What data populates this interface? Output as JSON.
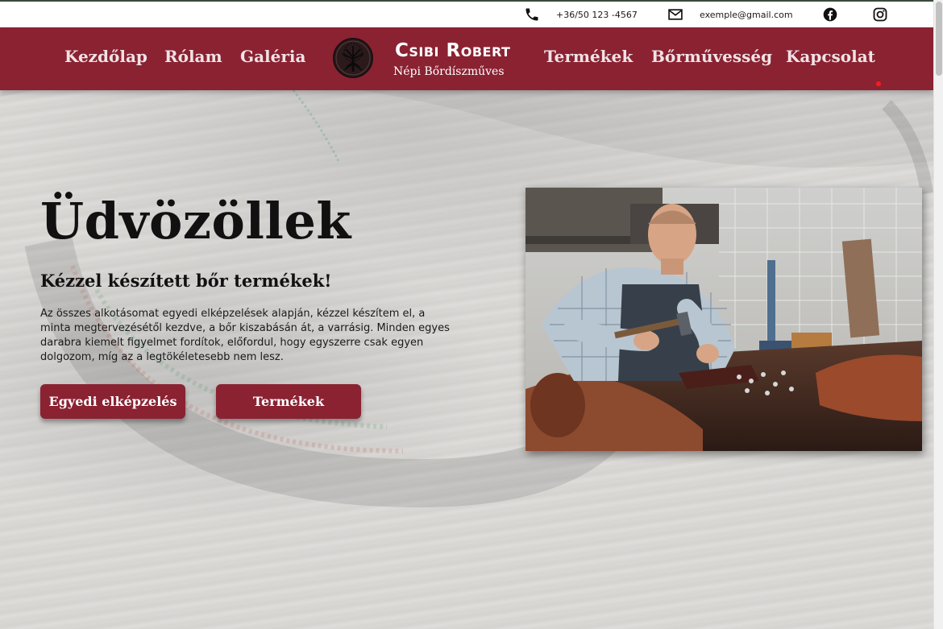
{
  "contact": {
    "phone": "+36/50 123 -4567",
    "email": "exemple@gmail.com",
    "phone_icon": "phone-icon",
    "email_icon": "mail-icon",
    "facebook_icon": "facebook-icon",
    "instagram_icon": "instagram-icon"
  },
  "nav": {
    "left": [
      "Kezdőlap",
      "Rólam",
      "Galéria"
    ],
    "right": [
      "Termékek",
      "Bőrművesség",
      "Kapcsolat"
    ],
    "brand_name": "Csibi Robert",
    "brand_subtitle": "Népi Bőrdíszműves"
  },
  "hero": {
    "title": "Üdvözöllek",
    "subtitle": "Kézzel készített bőr termékek!",
    "body": "Az összes alkotásomat egyedi elképzelések alapján, kézzel készítem el, a minta megtervezésétől kezdve, a bőr kiszabásán át, a varrásig. Minden egyes darabra kiemelt figyelmet fordítok, előfordul, hogy egyszerre csak egyen dolgozom, míg az a legtökéletesebb nem lesz.",
    "button_custom": "Egyedi elképzelés",
    "button_products": "Termékek"
  },
  "colors": {
    "brand": "#8a2232",
    "nav_text": "#efe3e5",
    "background": "#dcdbd8"
  }
}
